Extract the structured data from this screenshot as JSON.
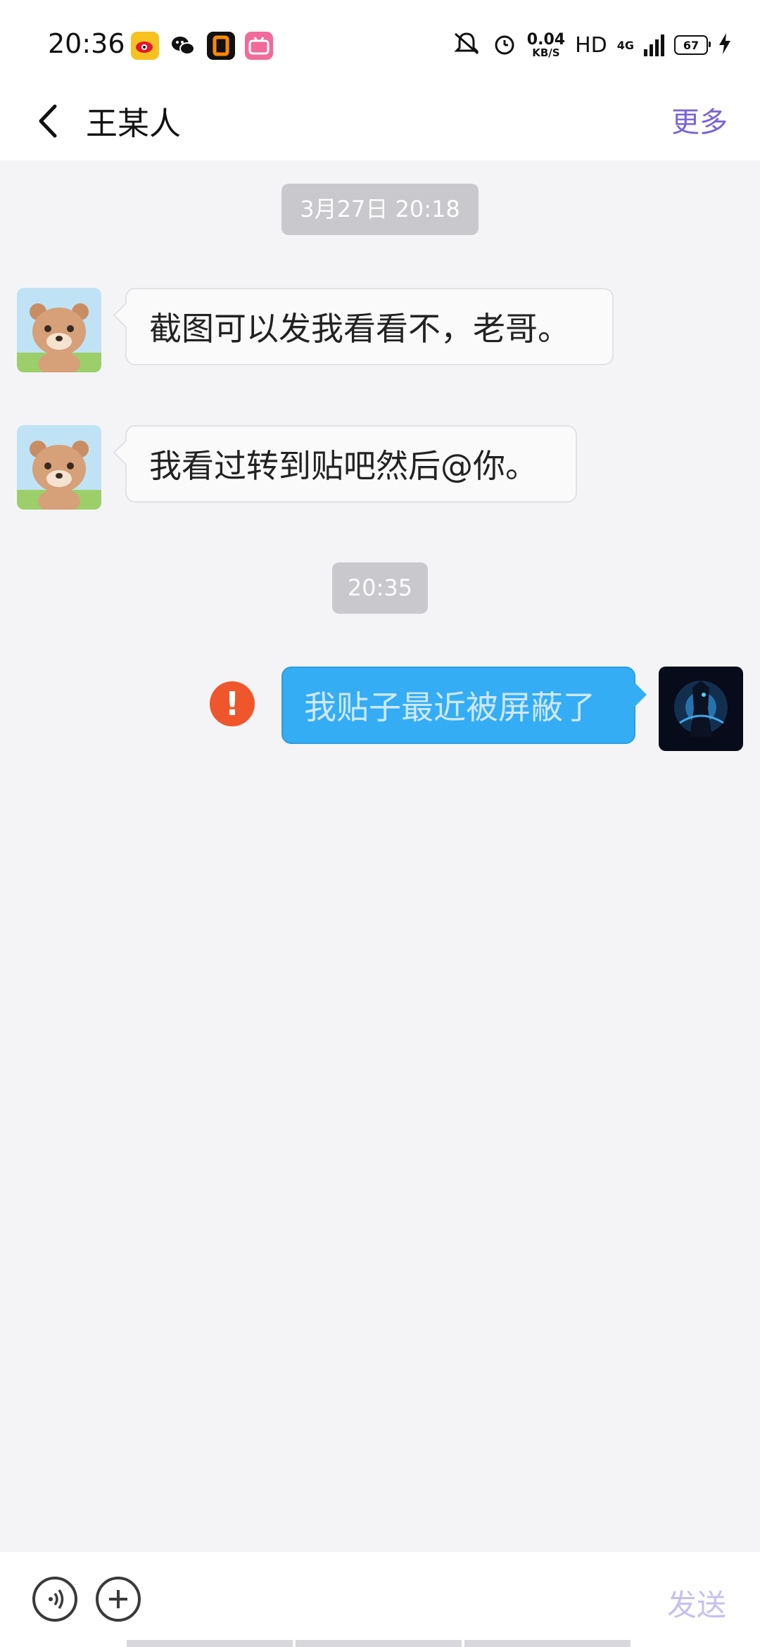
{
  "status_bar": {
    "time": "20:36",
    "net_speed_value": "0.04",
    "net_speed_unit": "KB/S",
    "hd": "HD",
    "network": "4G",
    "battery": "67",
    "app_icons": [
      "weibo-icon",
      "wechat-icon",
      "orange-app-icon",
      "bilibili-icon"
    ],
    "status_icons": [
      "mute-icon",
      "alarm-icon",
      "signal-icon",
      "battery-icon",
      "charging-icon"
    ]
  },
  "header": {
    "title": "王某人",
    "more_label": "更多"
  },
  "messages": {
    "ts1": "3月27日 20:18",
    "msg1": "截图可以发我看看不，老哥。",
    "msg2": "我看过转到贴吧然后@你。",
    "ts2": "20:35",
    "msg3": "我贴子最近被屏蔽了",
    "error_mark": "!"
  },
  "input_bar": {
    "send_label": "发送"
  },
  "colors": {
    "accent": "#7a63d6",
    "outgoing_bubble": "#34adf5",
    "error": "#f0562b",
    "background": "#f4f4f7"
  }
}
